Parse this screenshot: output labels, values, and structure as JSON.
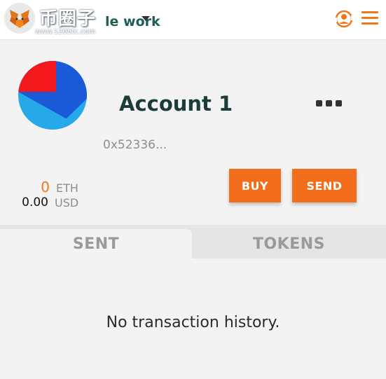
{
  "header": {
    "watermark_cn": "币圈子",
    "watermark_url": "www.120btc.com",
    "network_label": "le work",
    "brand_orange": "#f0771e",
    "icons": [
      "metamask-fox-icon",
      "chevron-down-icon",
      "support-icon",
      "hamburger-menu-icon"
    ]
  },
  "account": {
    "name": "Account 1",
    "address": "0x52336...",
    "identicon_colors": [
      "#f2181b",
      "#1a5ad8",
      "#27a9e9"
    ]
  },
  "balance": {
    "eth_amount": "0",
    "eth_unit": "ETH",
    "usd_amount": "0.00",
    "usd_unit": "USD"
  },
  "actions": {
    "buy_label": "BUY",
    "send_label": "SEND"
  },
  "tabs": [
    {
      "label": "SENT",
      "active": true
    },
    {
      "label": "TOKENS",
      "active": false
    }
  ],
  "history": {
    "empty_message": "No transaction history."
  }
}
